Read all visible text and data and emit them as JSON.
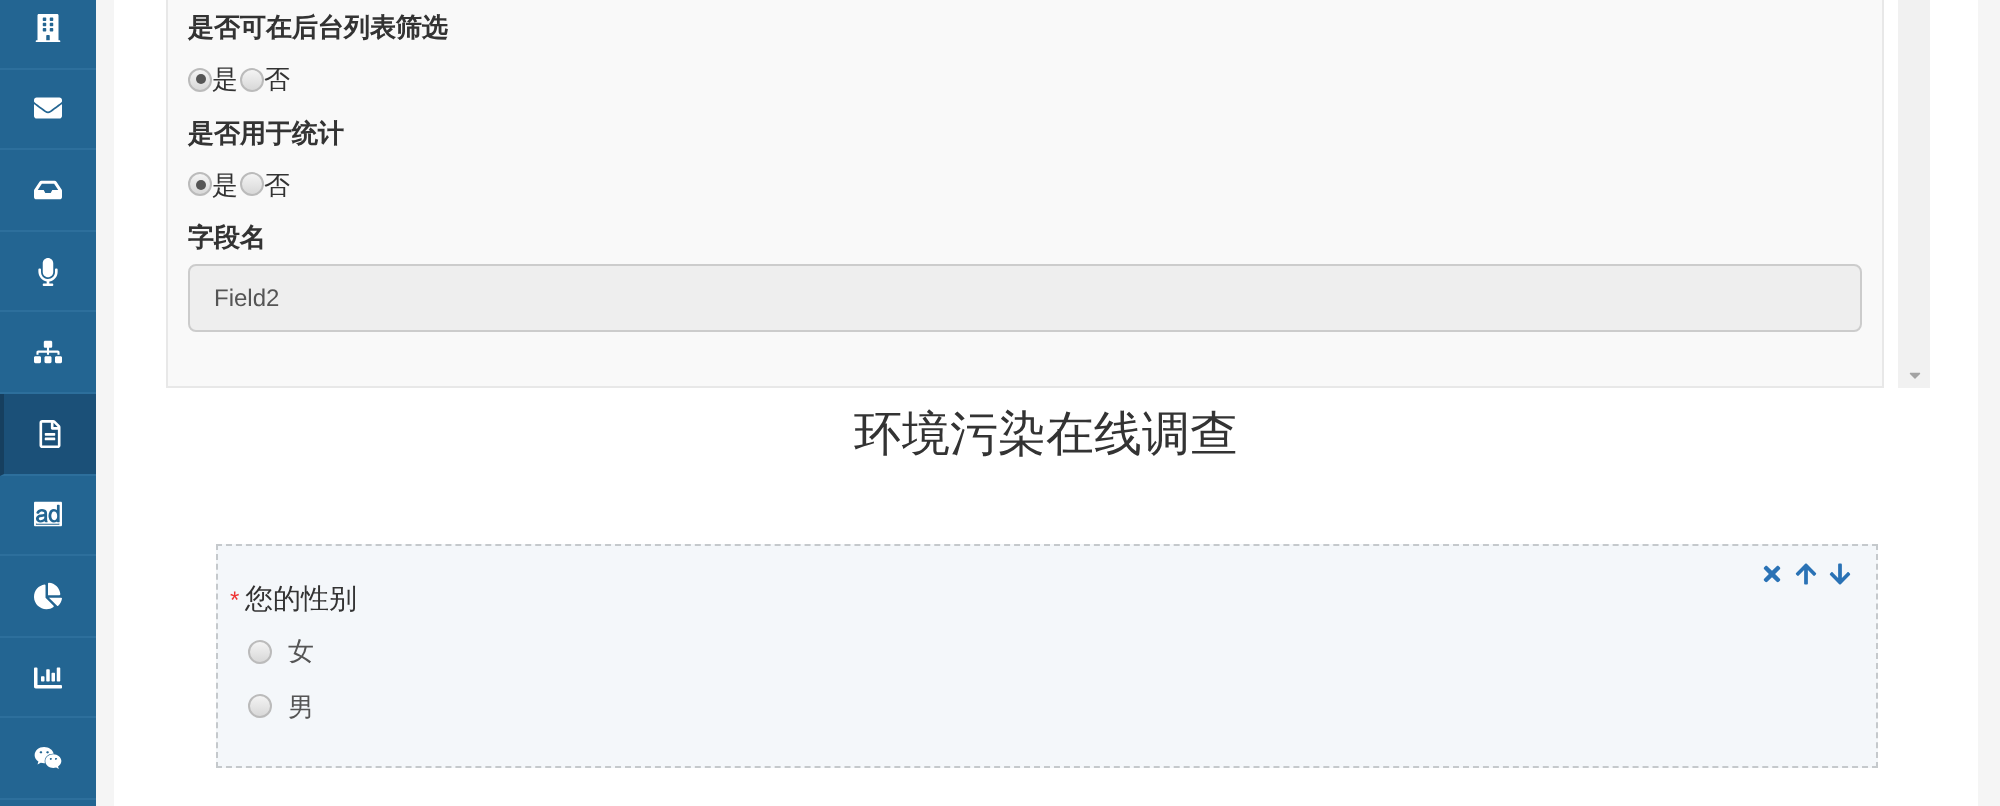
{
  "sidebar": {
    "items": [
      {
        "kind": "building",
        "selected": false
      },
      {
        "kind": "envelope",
        "selected": false
      },
      {
        "kind": "inbox",
        "selected": false
      },
      {
        "kind": "microphone",
        "selected": false
      },
      {
        "kind": "sitemap",
        "selected": false
      },
      {
        "kind": "document",
        "selected": true
      },
      {
        "kind": "ad",
        "selected": false
      },
      {
        "kind": "pie",
        "selected": false
      },
      {
        "kind": "bar",
        "selected": false
      },
      {
        "kind": "chat",
        "selected": false
      }
    ]
  },
  "settings_panel": {
    "fields": [
      {
        "kind": "radio",
        "label": "是否可在后台列表筛选",
        "options": [
          {
            "label": "是",
            "selected": true
          },
          {
            "label": "否",
            "selected": false
          }
        ]
      },
      {
        "kind": "radio",
        "label": "是否用于统计",
        "options": [
          {
            "label": "是",
            "selected": true
          },
          {
            "label": "否",
            "selected": false
          }
        ]
      },
      {
        "kind": "text",
        "label": "字段名",
        "value": "Field2"
      }
    ]
  },
  "survey": {
    "title": "环境污染在线调查",
    "questions": [
      {
        "required": true,
        "required_mark": "*",
        "label": "您的性别",
        "options": [
          {
            "label": "女",
            "selected": false
          },
          {
            "label": "男",
            "selected": false
          }
        ]
      }
    ]
  }
}
